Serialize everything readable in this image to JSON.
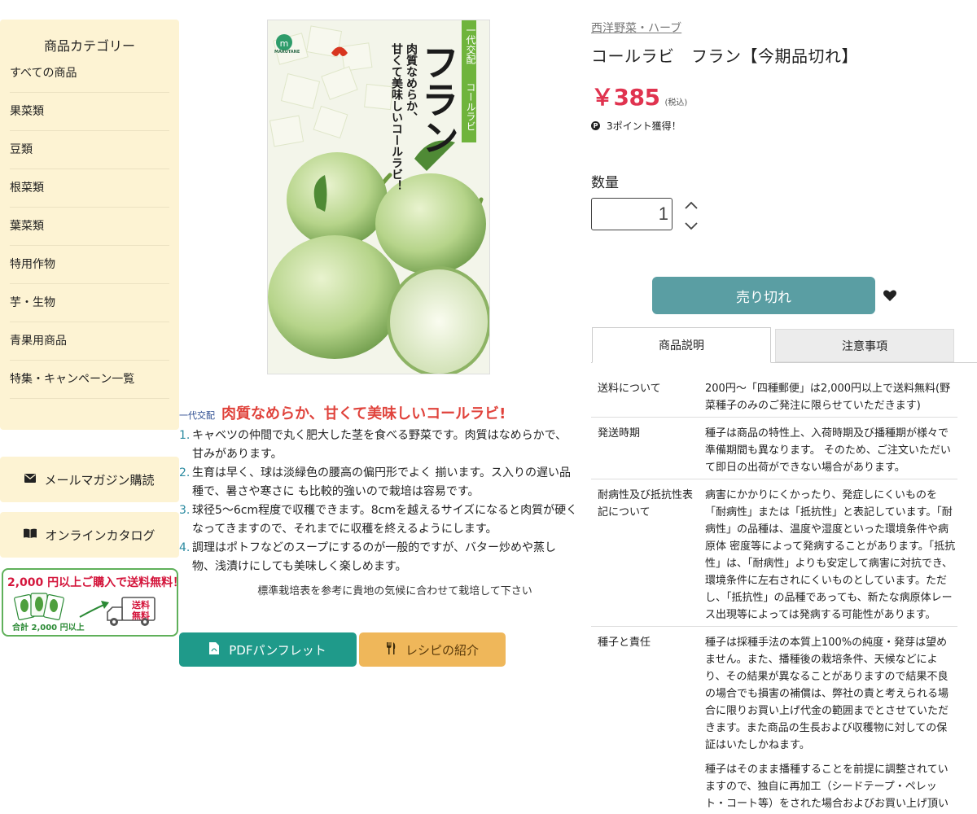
{
  "sidebar": {
    "title": "商品カテゴリー",
    "items": [
      {
        "label": "すべての商品"
      },
      {
        "label": "果菜類"
      },
      {
        "label": "豆類"
      },
      {
        "label": "根菜類"
      },
      {
        "label": "葉菜類"
      },
      {
        "label": "特用作物"
      },
      {
        "label": "芋・生物"
      },
      {
        "label": "青果用商品"
      },
      {
        "label": "特集・キャンペーン一覧"
      }
    ],
    "mail_label": "メールマガジン購読",
    "mail_icon": "envelope-icon",
    "catalog_label": "オンラインカタログ",
    "catalog_icon": "book-open-icon",
    "banner": {
      "amount": "2,000 円",
      "text": "以上ご購入で送料無料！",
      "truck_text_1": "送料",
      "truck_text_2": "無料",
      "bottom": "合計 2,000 円以上"
    }
  },
  "product_image": {
    "brand": "MARUTANE",
    "vertical_small_1": "一代交配",
    "vertical_small_2": "コールラビ",
    "vertical_title": "フラン",
    "vertical_copy_1": "肉質なめらか、",
    "vertical_copy_2": "甘くて美味しいコールラビ！"
  },
  "description": {
    "tag": "一代交配",
    "headline": "肉質なめらか、甘くて美味しいコールラビ!",
    "points": [
      {
        "num": "1.",
        "text": "キャベツの仲間で丸く肥大した茎を食べる野菜です。肉質はなめらかで、甘みがあります。"
      },
      {
        "num": "2.",
        "text": "生育は早く、球は淡緑色の腰高の偏円形でよく 揃います。ス入りの遅い品種で、暑さや寒さに も比較的強いので栽培は容易です。"
      },
      {
        "num": "3.",
        "text": "球径5〜6cm程度で収穫できます。8cmを越えるサイズになると肉質が硬くなってきますので、それまでに収穫を終えるようにします。"
      },
      {
        "num": "4.",
        "text": "調理はポトフなどのスープにするのが一般的ですが、バター炒めや蒸し物、浅漬けにしても美味しく楽しめます。"
      }
    ],
    "note": "標準栽培表を参考に貴地の気候に合わせて栽培して下さい"
  },
  "buttons": {
    "pdf_label": "PDFパンフレット",
    "pdf_icon": "file-pdf-icon",
    "recipe_label": "レシピの紹介",
    "recipe_icon": "utensils-icon",
    "soldout_label": "売り切れ",
    "favorite_icon": "heart-icon"
  },
  "product": {
    "breadcrumb": "西洋野菜・ハーブ",
    "title": "コールラビ　フラン【今期品切れ】",
    "price": "￥385",
    "tax": "(税込)",
    "points": "3ポイント獲得！",
    "points_icon": "P"
  },
  "quantity": {
    "label": "数量",
    "value": "1"
  },
  "tabs": [
    {
      "label": "商品説明"
    },
    {
      "label": "注意事項"
    }
  ],
  "spec_rows": [
    {
      "key": "送料について",
      "value": [
        "200円〜「四種郵便」は2,000円以上で送料無料(野菜種子のみのご発注に限らせていただきます)"
      ]
    },
    {
      "key": "発送時期",
      "value": [
        "種子は商品の特性上、入荷時期及び播種期が様々で準備期間も異なります。 そのため、ご注文いただいて即日の出荷ができない場合があります。"
      ]
    },
    {
      "key": "耐病性及び抵抗性表記について",
      "value": [
        "病害にかかりにくかったり、発症しにくいものを「耐病性」または「抵抗性」と表記しています。「耐病性」の品種は、温度や湿度といった環境条件や病原体 密度等によって発病することがあります。「抵抗性」は、「耐病性」よりも安定して病害に対抗でき、環境条件に左右されにくいものとしています。ただし、「抵抗性」の品種であっても、新たな病原体レース出現等によっては発病する可能性があります。"
      ]
    },
    {
      "key": "種子と責任",
      "value": [
        "種子は採種手法の本質上100%の純度・発芽は望めません。また、播種後の栽培条件、天候などにより、その結果が異なることがありますので結果不良の場合でも損害の補償は、弊社の責と考えられる場合に限りお買い上げ代金の範囲までとさせていただきます。また商品の生長および収穫物に対しての保証はいたしかねます。",
        "種子はそのまま播種することを前提に調整されていますので、独自に再加工（シードテープ・ペレット・コート等）をされた場合およびお買い上げ頂いた種子の自家採種（取り返し）種子につきましては、責任を負いかねますのでご了承ください。"
      ]
    }
  ],
  "colors": {
    "sidebar_bg": "#fdf3d3",
    "price": "#e0334f",
    "soldout": "#5a9ea3",
    "pdf": "#1f9a8a",
    "recipe": "#efb75a"
  }
}
